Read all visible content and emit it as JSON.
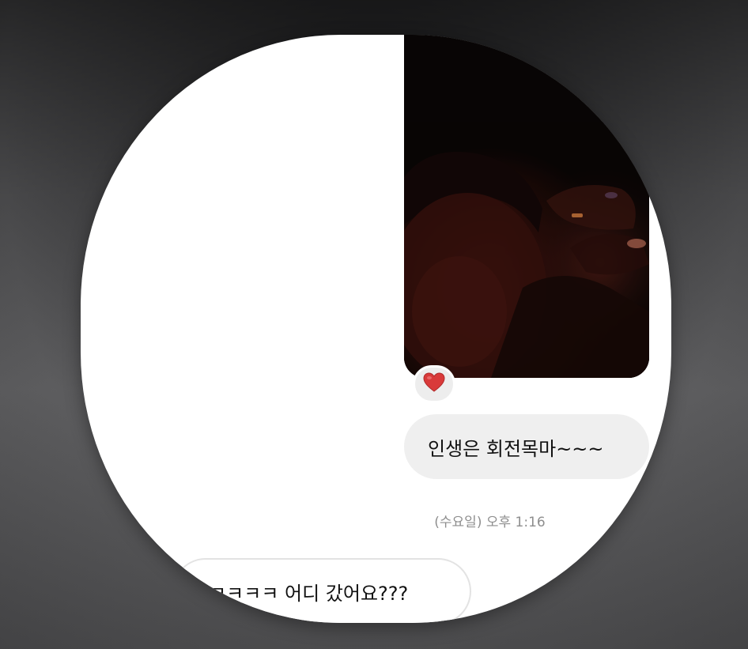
{
  "conversation": {
    "photo_message": {
      "reaction": "❤️"
    },
    "sent_message": {
      "text": "인생은 회전목마~~~"
    },
    "timestamp": "(수요일) 오후 1:16",
    "received_message": {
      "text": "ㅋㅋㅋㅋㅋ 어디 갔어요???"
    }
  }
}
